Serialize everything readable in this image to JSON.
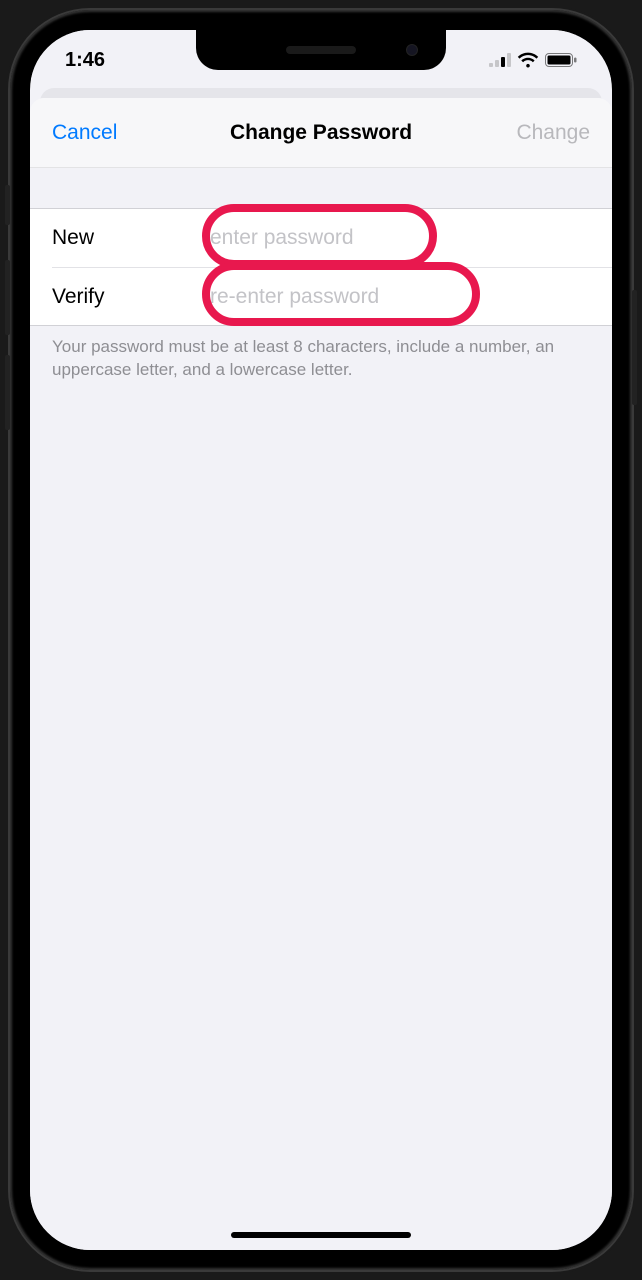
{
  "status_bar": {
    "time": "1:46"
  },
  "nav": {
    "left": "Cancel",
    "title": "Change Password",
    "right": "Change"
  },
  "form": {
    "new_label": "New",
    "new_placeholder": "enter password",
    "verify_label": "Verify",
    "verify_placeholder": "re-enter password"
  },
  "footer": "Your password must be at least 8 characters, include a number, an uppercase letter, and a lowercase letter.",
  "colors": {
    "tint": "#007aff",
    "disabled": "#b8b8bc",
    "highlight": "#e8184e"
  }
}
